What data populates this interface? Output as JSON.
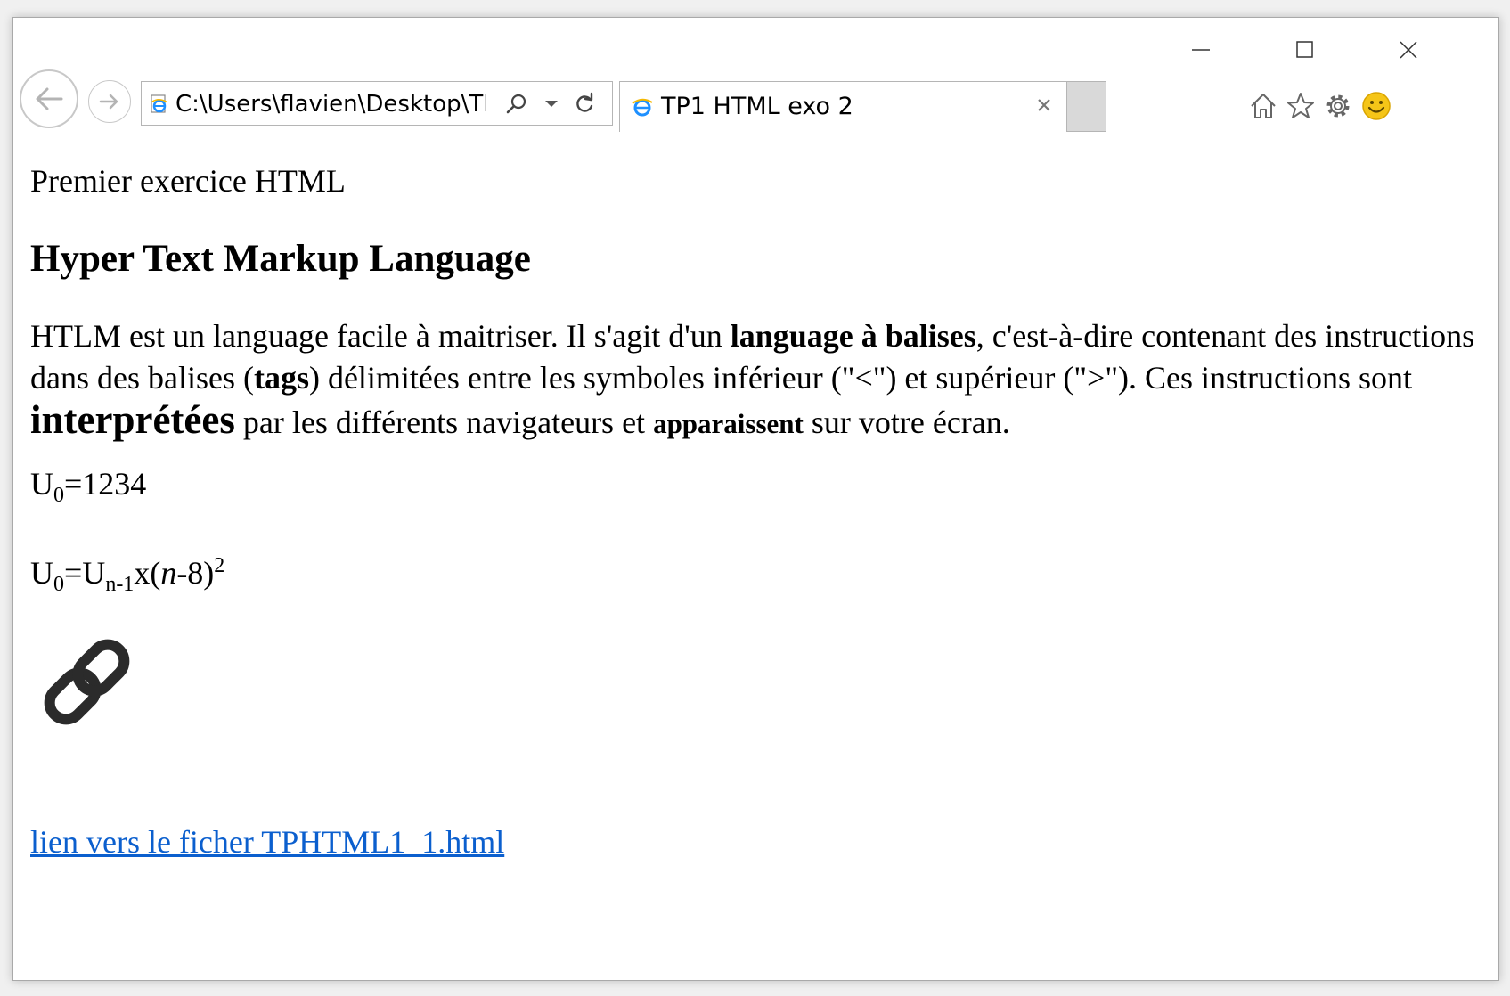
{
  "window": {
    "address_url": "C:\\Users\\flavien\\Desktop\\TP",
    "tab_title": "TP1 HTML exo 2"
  },
  "icons": {
    "minimize": "minimize-icon",
    "maximize": "maximize-icon",
    "close": "close-icon",
    "back": "back-arrow-icon",
    "forward": "forward-arrow-icon",
    "page": "ie-page-icon",
    "search": "search-icon",
    "dropdown": "chevron-down-icon",
    "refresh": "refresh-icon",
    "tab_close": "close-icon",
    "home": "home-icon",
    "favorites": "star-icon",
    "settings": "gear-icon",
    "feedback": "smiley-icon",
    "image": "chain-link-icon"
  },
  "colors": {
    "link": "#0b5fce",
    "ie_blue": "#1e90ff",
    "smiley": "#f5c518"
  },
  "content": {
    "title": "Premier exercice HTML",
    "heading": "Hyper Text Markup Language",
    "paragraph": {
      "p1": "HTLM est un language facile à maitriser. Il s'agit d'un ",
      "b1": "language à balises",
      "p2": ", c'est-à-dire contenant des instructions dans des balises (",
      "b2": "tags",
      "p3": ") délimitées entre les symboles inférieur (\"<\") et supérieur (\">\"). Ces instructions sont ",
      "big": "interprétées",
      "p4": " par les différents navigateurs et ",
      "small": "apparaissent",
      "p5": " sur votre écran."
    },
    "formula1": {
      "base": "U",
      "sub": "0",
      "rest": "=1234"
    },
    "formula2": {
      "base": "U",
      "sub": "0",
      "eq": "=U",
      "sub2": "n-1",
      "x": "x(",
      "n": "n",
      "rest": "-8)",
      "sup": "2"
    },
    "link_text": "lien vers le ficher TPHTML1_1.html"
  }
}
